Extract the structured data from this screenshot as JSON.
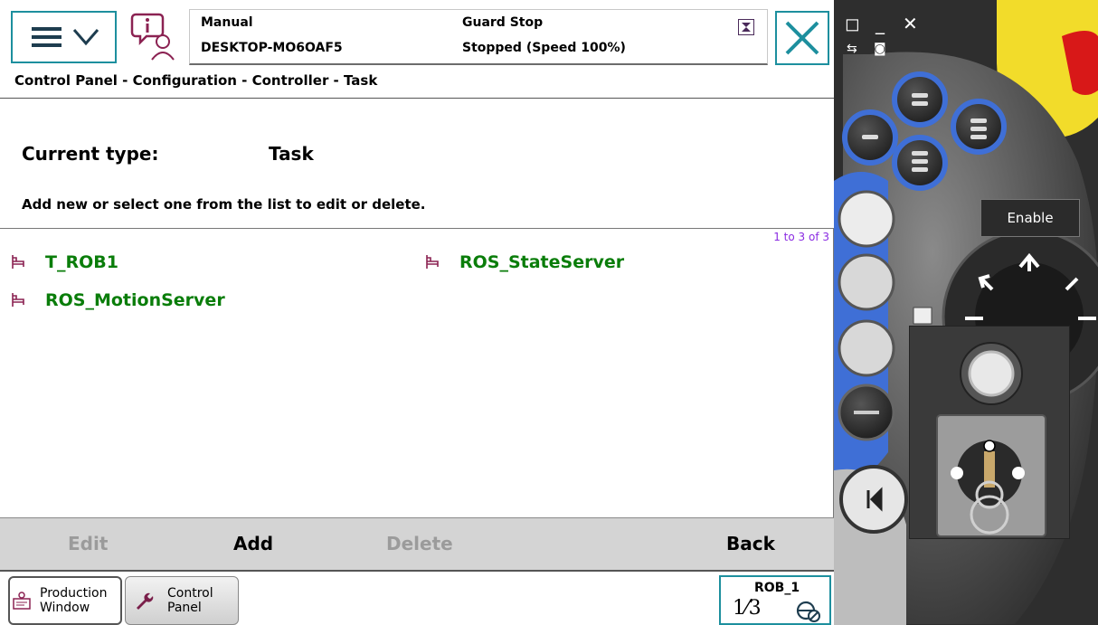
{
  "status": {
    "mode": "Manual",
    "hostname": "DESKTOP-MO6OAF5",
    "guard": "Guard Stop",
    "state": "Stopped (Speed 100%)"
  },
  "breadcrumb": "Control Panel - Configuration - Controller - Task",
  "current_type": {
    "label": "Current type:",
    "value": "Task"
  },
  "instructions": "Add new or select one from the list to edit or delete.",
  "list": {
    "count": "1 to 3 of 3",
    "items": [
      {
        "label": "T_ROB1"
      },
      {
        "label": "ROS_StateServer"
      },
      {
        "label": "ROS_MotionServer"
      }
    ]
  },
  "commands": {
    "edit": "Edit",
    "add": "Add",
    "delete": "Delete",
    "back": "Back"
  },
  "taskbar": {
    "production_window": [
      "Production",
      "Window"
    ],
    "control_panel": [
      "Control",
      "Panel"
    ],
    "rob": {
      "label": "ROB_1",
      "fraction": "1⁄3"
    }
  },
  "device": {
    "enable_label": "Enable"
  },
  "colors": {
    "accent": "#1d8f9e",
    "task_green": "#0a7d0a",
    "count_purple": "#8a2be2",
    "housing_blue": "#3f6fd6",
    "housing_yellow": "#f2dc2a",
    "estop_red": "#d81818"
  }
}
